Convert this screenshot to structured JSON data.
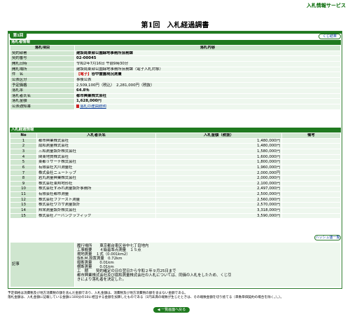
{
  "header": {
    "service": "入札情報サービス",
    "title": "第1回　入札経過調書"
  },
  "tab_label": "第1回",
  "buttons": {
    "close": "くじ結果",
    "hash": "ハッシュ値一覧",
    "back": "◀ 一覧画面へ戻る"
  },
  "result": {
    "section": "落札者情報",
    "headers": [
      "落札項目",
      "落札内容"
    ],
    "rows": [
      {
        "label": "契約部署",
        "value": "建設局東部公園緑地事務所庶務課",
        "bold": true
      },
      {
        "label": "契約番号",
        "value": "02-00045",
        "bold": true
      },
      {
        "label": "開札日時",
        "value": "令和2年7月16日 午前9時30分"
      },
      {
        "label": "開札場所",
        "value": "建設局東部公園緑地事務所庶務課（電子入札対象）"
      },
      {
        "label": "件　名",
        "tag": "【電子】",
        "value": "谷中霊園現況測量",
        "bold": true
      },
      {
        "label": "公表区分",
        "value": "事後公表"
      },
      {
        "label": "予定価格",
        "value": "2,509,100円（税込）　2,281,000円（税抜）"
      },
      {
        "label": "落札率",
        "value": "64.8％",
        "bold": true
      },
      {
        "label": "落札者氏名",
        "value": "都市興業株式会社",
        "bold": true
      },
      {
        "label": "落札金額",
        "value": "1,628,000円",
        "bold": true
      },
      {
        "label": "公表通知書",
        "value": "落札の理由説明",
        "link": true
      }
    ]
  },
  "bids": {
    "section": "入札経過情報",
    "headers": [
      "No",
      "入札者氏名",
      "入札金額（税抜）",
      "備考"
    ],
    "rows": [
      {
        "no": "1",
        "name": "都市興業株式会社",
        "amount": "1,480,000円"
      },
      {
        "no": "2",
        "name": "扇和測量株式会社",
        "amount": "1,480,000円"
      },
      {
        "no": "3",
        "name": "三和測量設計株式会社",
        "amount": "1,580,000円"
      },
      {
        "no": "4",
        "name": "関東地質株式会社",
        "amount": "1,600,000円"
      },
      {
        "no": "5",
        "name": "東都リサーチ株式会社",
        "amount": "1,800,000円"
      },
      {
        "no": "6",
        "name": "有限会社大川測量社",
        "amount": "1,960,000円"
      },
      {
        "no": "7",
        "name": "株式会社ニュートップ",
        "amount": "2,000,000円"
      },
      {
        "no": "8",
        "name": "岩丸測量興業株式会社",
        "amount": "2,000,000円"
      },
      {
        "no": "9",
        "name": "株式会社東邦地形社",
        "amount": "2,100,000円"
      },
      {
        "no": "10",
        "name": "株式会社すみれ測量設計事務所",
        "amount": "2,497,000円"
      },
      {
        "no": "11",
        "name": "有限会社都市測量",
        "amount": "2,500,000円"
      },
      {
        "no": "12",
        "name": "株式会社ファースト測量",
        "amount": "2,560,000円"
      },
      {
        "no": "13",
        "name": "株式会社ワカサ測量設計",
        "amount": "2,570,000円"
      },
      {
        "no": "14",
        "name": "邦栄測量設計株式会社",
        "amount": "3,318,000円"
      },
      {
        "no": "15",
        "name": "株式会社アーバングラフィック",
        "amount": "3,590,000円"
      }
    ]
  },
  "notes": {
    "label": "記事",
    "lines": [
      "履行場所　　東京都台東区谷中七丁目地内",
      "工事概要　　４級基準点測量　１５点",
      "現地測量　１式（0.001km2）",
      "仮B.M.設置測量　0.72km",
      "縦断測量　　0.01km",
      "横断測量　　0.01km",
      "工　期　　契約確定の日の翌日から令和２年９月25日まで",
      "都市興業株式会社及び扇和測量株式会社の入札については、同価の入札をしたため、くじ引",
      "きにより落札者を決定した。"
    ]
  },
  "footer": [
    "予定価格は消費税及び地方消費税の額を含んだ金額であり、入札金額は、消費税及び地方消費税の額を含まない金額である。",
    "落札金額は、入札金額に記載している金額に100分の10に相当する金額を加算したものである（1円未満の端数が生じたときは、その端数金額を切り捨てる（単数単価契約の場合を除く。）。）。"
  ]
}
